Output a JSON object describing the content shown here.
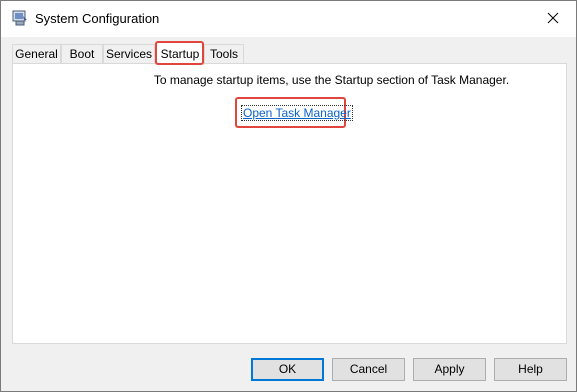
{
  "window": {
    "title": "System Configuration",
    "close_label": "✕"
  },
  "tabs": [
    {
      "label": "General",
      "active": false
    },
    {
      "label": "Boot",
      "active": false
    },
    {
      "label": "Services",
      "active": false
    },
    {
      "label": "Startup",
      "active": true
    },
    {
      "label": "Tools",
      "active": false
    }
  ],
  "startup": {
    "info_text": "To manage startup items, use the Startup section of Task Manager.",
    "link_label": "Open Task Manager"
  },
  "buttons": {
    "ok": "OK",
    "cancel": "Cancel",
    "apply": "Apply",
    "help": "Help"
  },
  "colors": {
    "highlight": "#e0463c",
    "link": "#0b62c7",
    "accent": "#0078d7"
  }
}
